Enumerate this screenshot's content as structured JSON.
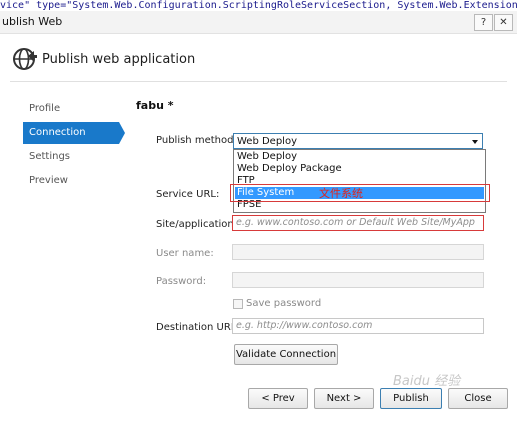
{
  "code_snippet": "vice\" type=\"System.Web.Configuration.ScriptingRoleServiceSection, System.Web.Extensions, Version",
  "window": {
    "title": "ublish Web",
    "help_label": "?",
    "close_label": "✕"
  },
  "header": {
    "title": "Publish web application",
    "icon": "globe-publish-icon"
  },
  "nav": {
    "items": [
      {
        "label": "Profile",
        "active": false
      },
      {
        "label": "Connection",
        "active": true
      },
      {
        "label": "Settings",
        "active": false
      },
      {
        "label": "Preview",
        "active": false
      }
    ]
  },
  "profile_name": "fabu *",
  "form": {
    "publish_method_label": "Publish method:",
    "publish_method_value": "Web Deploy",
    "publish_method_options": [
      "Web Deploy",
      "Web Deploy Package",
      "FTP",
      "File System",
      "FPSE"
    ],
    "highlighted_option": "File System",
    "annotation": "文件系统",
    "service_url_label": "Service URL:",
    "site_app_label": "Site/application:",
    "site_app_placeholder": "e.g. www.contoso.com or Default Web Site/MyApp",
    "user_name_label": "User name:",
    "password_label": "Password:",
    "save_password_label": "Save password",
    "destination_url_label": "Destination URL:",
    "destination_url_placeholder": "e.g. http://www.contoso.com",
    "validate_button": "Validate Connection"
  },
  "footer": {
    "prev": "< Prev",
    "next": "Next >",
    "publish": "Publish",
    "close": "Close"
  },
  "watermark": "Baidu 经验",
  "colors": {
    "accent": "#1979ca",
    "highlight": "#3399ff",
    "annotation": "#e2231a"
  }
}
